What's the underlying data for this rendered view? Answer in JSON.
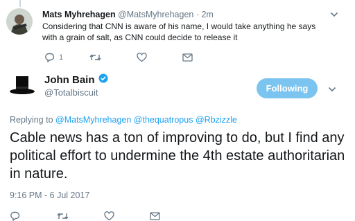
{
  "reply_tweet": {
    "author_name": "Mats Myhrehagen",
    "author_handle": "@MatsMyhrehagen",
    "separator": "·",
    "time": "2m",
    "text": "Considering that CNN is aware of his name, I would take anything he says with a grain of salt, as CNN could decide to release it",
    "reply_count": "1",
    "icons": [
      "reply-icon",
      "retweet-icon",
      "like-icon",
      "direct-message-icon",
      "chevron-down-icon"
    ]
  },
  "main_tweet": {
    "author_name": "John Bain",
    "author_handle": "@Totalbiscuit",
    "verified": true,
    "follow_button_label": "Following",
    "replying_prefix": "Replying to",
    "mentions": [
      "@MatsMyhrehagen",
      "@thequatropus",
      "@Rbzizzle"
    ],
    "text": "Cable news has a ton of improving to do, but I find any political effort to undermine the 4th estate authoritarian in nature.",
    "timestamp": "9:16 PM - 6 Jul 2017"
  },
  "colors": {
    "accent": "#1da1f2",
    "following_button": "#7cc4f0",
    "secondary_text": "#657786",
    "primary_text": "#14171a"
  }
}
